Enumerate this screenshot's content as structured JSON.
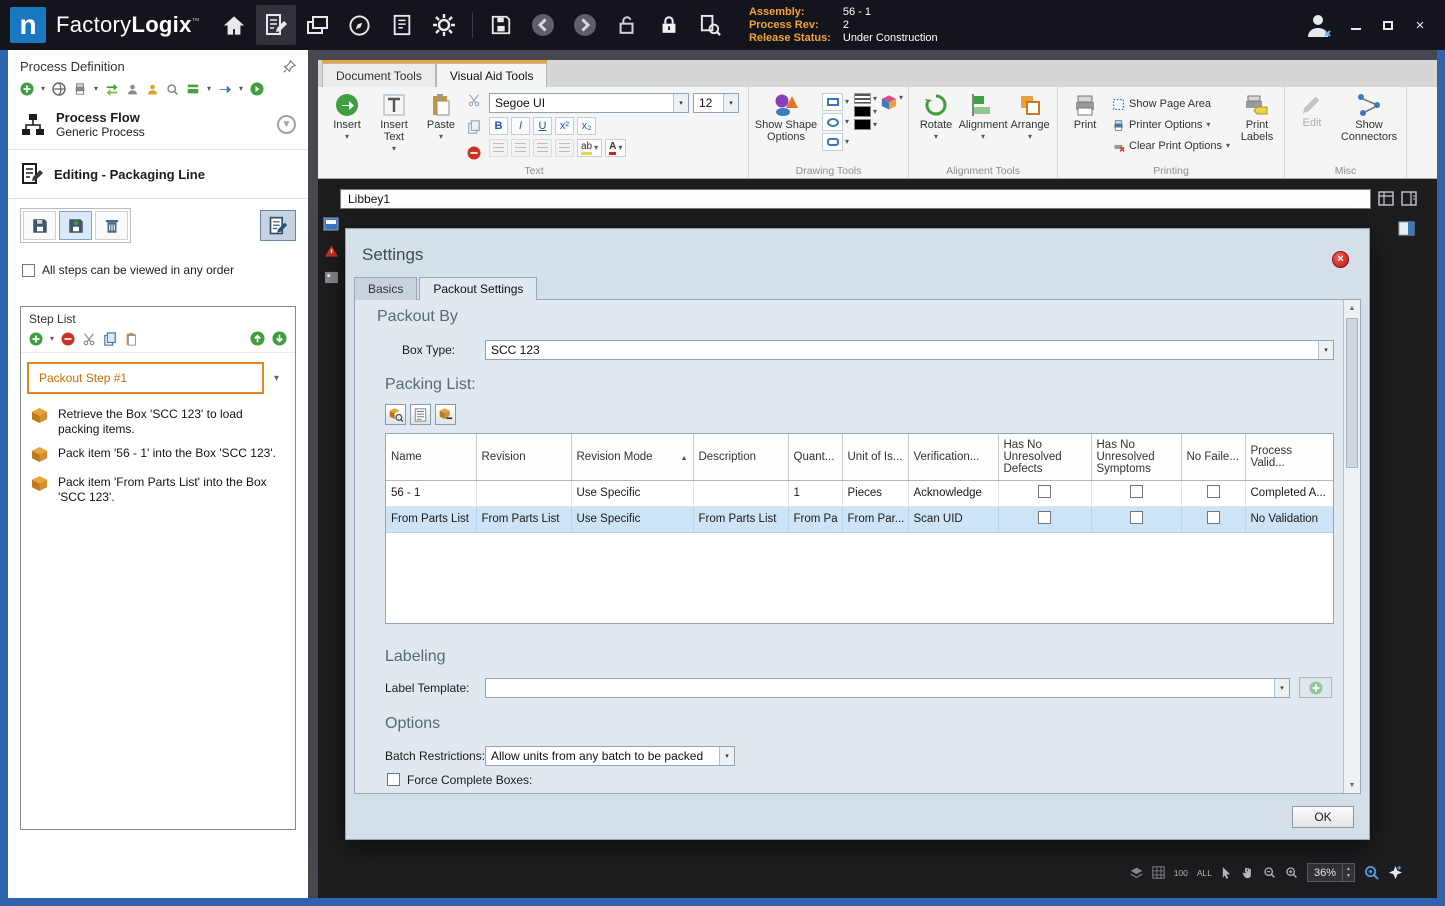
{
  "icons": {
    "caret_down": "▾",
    "sort_asc": "▲",
    "arrow_up": "▲",
    "arrow_down": "▼",
    "close": "×"
  },
  "titlebar": {
    "logo_letter": "n",
    "brand_1": "Factory",
    "brand_2": "Logix",
    "tm": "™",
    "info": {
      "assembly_label": "Assembly:",
      "assembly_value": "56 - 1",
      "process_rev_label": "Process Rev:",
      "process_rev_value": "2",
      "release_status_label": "Release Status:",
      "release_status_value": "Under Construction"
    }
  },
  "sidebar": {
    "title": "Process Definition",
    "process_flow_title": "Process Flow",
    "process_flow_subtitle": "Generic Process",
    "editing_label": "Editing - Packaging Line",
    "order_checkbox_label": "All steps can be viewed in any order",
    "step_list_title": "Step List",
    "selected_step_label": "Packout Step #1",
    "steps": [
      "Retrieve the Box 'SCC 123' to load packing items.",
      "Pack item '56 - 1' into the Box 'SCC 123'.",
      "Pack item 'From Parts List' into the Box 'SCC 123'."
    ]
  },
  "ribbon": {
    "tab_document": "Document Tools",
    "tab_visual": "Visual Aid Tools",
    "insert_label": "Insert",
    "insert_text_label": "Insert Text",
    "paste_label": "Paste",
    "font_name": "Segoe UI",
    "font_size": "12",
    "fmt": {
      "bold": "B",
      "italic": "I",
      "underline": "U",
      "sup": "x²",
      "sub": "x₂",
      "highlight": "ab",
      "font_color": "A"
    },
    "show_shape_options": "Show Shape Options",
    "rotate_label": "Rotate",
    "alignment_label": "Alignment",
    "arrange_label": "Arrange",
    "print_label": "Print",
    "show_page_area": "Show Page Area",
    "printer_options": "Printer Options",
    "clear_print_options": "Clear Print Options",
    "print_labels": "Print Labels",
    "edit_label": "Edit",
    "show_connectors": "Show Connectors",
    "group_text": "Text",
    "group_drawing": "Drawing Tools",
    "group_alignment": "Alignment Tools",
    "group_printing": "Printing",
    "group_misc": "Misc"
  },
  "canvas": {
    "doc_name": "Libbey1",
    "zoom_value": "36%",
    "status_100": "100",
    "status_all": "ALL"
  },
  "dialog": {
    "title": "Settings",
    "tab_basics": "Basics",
    "tab_packout": "Packout Settings",
    "packout_by_heading": "Packout By",
    "box_type_label": "Box Type:",
    "box_type_value": "SCC 123",
    "packing_list_heading": "Packing List:",
    "columns": [
      "Name",
      "Revision",
      "Revision Mode",
      "Description",
      "Quant...",
      "Unit of Is...",
      "Verification...",
      "Has No Unresolved Defects",
      "Has No Unresolved Symptoms",
      "No Faile...",
      "Process Valid..."
    ],
    "rows": [
      {
        "name": "56 - 1",
        "revision": "",
        "revision_mode": "Use Specific",
        "description": "",
        "quantity": "1",
        "unit": "Pieces",
        "verification": "Acknowledge",
        "process_validation": "Completed A..."
      },
      {
        "name": "From Parts List",
        "revision": "From Parts List",
        "revision_mode": "Use Specific",
        "description": "From Parts List",
        "quantity": "From Pa",
        "unit": "From Par...",
        "verification": "Scan UID",
        "process_validation": "No Validation"
      }
    ],
    "labeling_heading": "Labeling",
    "label_template_label": "Label Template:",
    "label_template_value": "",
    "options_heading": "Options",
    "batch_restrictions_label": "Batch Restrictions:",
    "batch_restrictions_value": "Allow units from any batch to be packed",
    "force_complete_label": "Force Complete Boxes:",
    "ok_label": "OK"
  }
}
